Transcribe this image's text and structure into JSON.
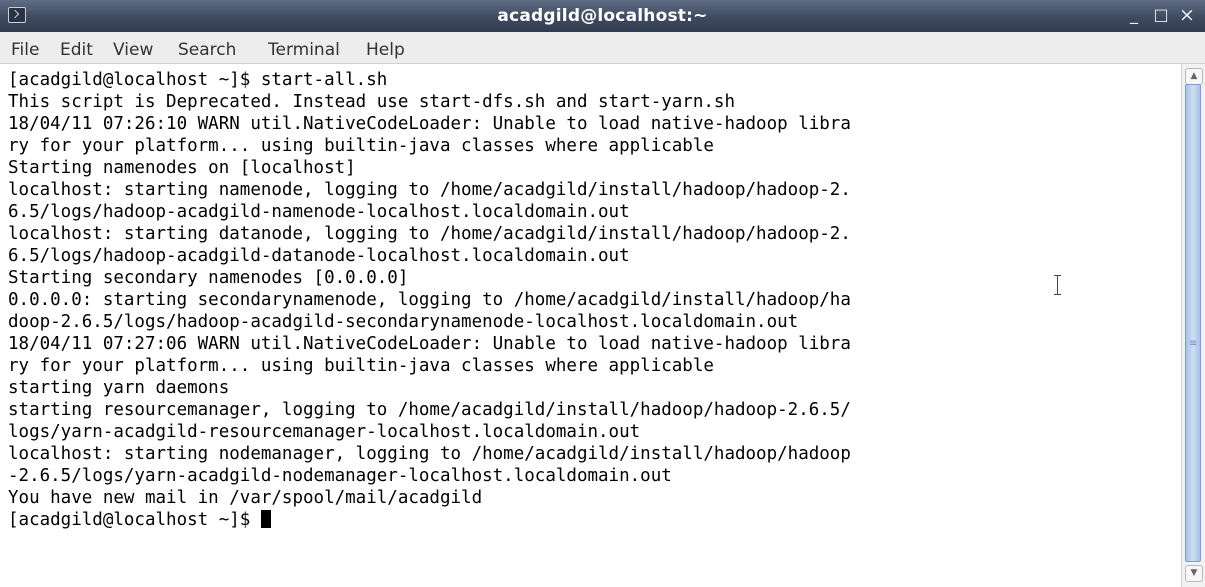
{
  "window": {
    "title": "acadgild@localhost:~",
    "controls": {
      "minimize": "_",
      "maximize": "□",
      "close": "×"
    }
  },
  "menubar": {
    "items": [
      {
        "label": "File"
      },
      {
        "label": "Edit"
      },
      {
        "label": "View"
      },
      {
        "label": "Search"
      },
      {
        "label": "Terminal"
      },
      {
        "label": "Help"
      }
    ]
  },
  "terminal": {
    "lines": [
      "[acadgild@localhost ~]$ start-all.sh",
      "This script is Deprecated. Instead use start-dfs.sh and start-yarn.sh",
      "18/04/11 07:26:10 WARN util.NativeCodeLoader: Unable to load native-hadoop libra",
      "ry for your platform... using builtin-java classes where applicable",
      "Starting namenodes on [localhost]",
      "localhost: starting namenode, logging to /home/acadgild/install/hadoop/hadoop-2.",
      "6.5/logs/hadoop-acadgild-namenode-localhost.localdomain.out",
      "localhost: starting datanode, logging to /home/acadgild/install/hadoop/hadoop-2.",
      "6.5/logs/hadoop-acadgild-datanode-localhost.localdomain.out",
      "Starting secondary namenodes [0.0.0.0]",
      "0.0.0.0: starting secondarynamenode, logging to /home/acadgild/install/hadoop/ha",
      "doop-2.6.5/logs/hadoop-acadgild-secondarynamenode-localhost.localdomain.out",
      "18/04/11 07:27:06 WARN util.NativeCodeLoader: Unable to load native-hadoop libra",
      "ry for your platform... using builtin-java classes where applicable",
      "starting yarn daemons",
      "starting resourcemanager, logging to /home/acadgild/install/hadoop/hadoop-2.6.5/",
      "logs/yarn-acadgild-resourcemanager-localhost.localdomain.out",
      "localhost: starting nodemanager, logging to /home/acadgild/install/hadoop/hadoop",
      "-2.6.5/logs/yarn-acadgild-nodemanager-localhost.localdomain.out",
      "You have new mail in /var/spool/mail/acadgild"
    ],
    "prompt": "[acadgild@localhost ~]$ "
  },
  "scrollbar": {
    "up_arrow": "▲",
    "down_arrow": "▼",
    "grip": "≡"
  },
  "colors": {
    "titlebar": "#3e4a60",
    "menubar": "#ededed",
    "terminal_bg": "#ffffff",
    "terminal_fg": "#000000",
    "scroll_thumb": "#a9c2e6"
  }
}
